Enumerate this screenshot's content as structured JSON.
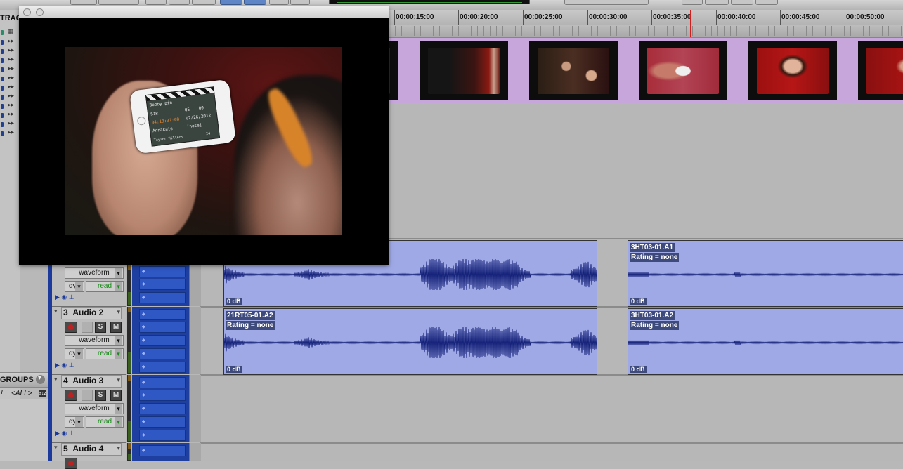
{
  "ruler": {
    "ticks": [
      "00:00:15:00",
      "00:00:20:00",
      "00:00:25:00",
      "00:00:30:00",
      "00:00:35:00",
      "00:00:40:00",
      "00:00:45:00",
      "00:00:50:00"
    ]
  },
  "sidebar": {
    "tracks_header": "TRACKS",
    "groups_header": "GROUPS",
    "groups_row": {
      "bang": "!",
      "all": "<ALL>"
    }
  },
  "tracks": [
    {
      "num": "",
      "name": "",
      "view": "waveform",
      "automation": "dyn",
      "mode": "read"
    },
    {
      "num": "3",
      "name": "Audio 2",
      "view": "waveform",
      "automation": "dyn",
      "mode": "read",
      "solo": "S",
      "mute": "M"
    },
    {
      "num": "4",
      "name": "Audio 3",
      "view": "waveform",
      "automation": "dyn",
      "mode": "read",
      "solo": "S",
      "mute": "M"
    },
    {
      "num": "5",
      "name": "Audio 4"
    }
  ],
  "regions": [
    {
      "name": "",
      "rating": "",
      "gain": "0 dB"
    },
    {
      "name": "3HT03-01.A1",
      "rating": "Rating = none",
      "gain": "0 dB"
    },
    {
      "name": "21RT05-01.A2",
      "rating": "Rating = none",
      "gain": "0 dB"
    },
    {
      "name": "3HT03-01.A2",
      "rating": "Rating = none",
      "gain": "0 dB"
    }
  ],
  "video_window": {
    "clap": {
      "line1": "Bobby pin",
      "scene": "S1R",
      "take": "05",
      "roll": "00",
      "tc": "04:13:37:08",
      "date": "02/26/2012",
      "camera": "Annakate",
      "note": "[note]",
      "footer": "Taylor Hillers",
      "fps": "24"
    }
  },
  "colors": {
    "region": "#9fa9e6",
    "waveform": "#16237a",
    "video_track": "#c7a6dc",
    "track_blue": "#1b3a9c",
    "cursor": "#d41d1d"
  }
}
